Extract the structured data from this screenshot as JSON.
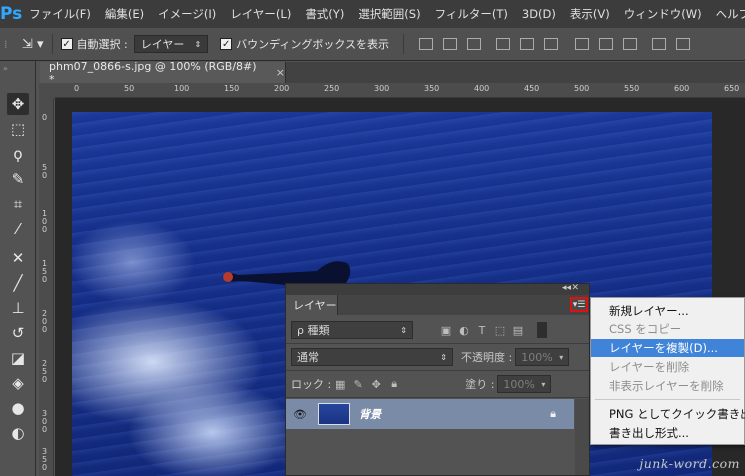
{
  "app": {
    "logo": "Ps"
  },
  "menubar": {
    "items": [
      "ファイル(F)",
      "編集(E)",
      "イメージ(I)",
      "レイヤー(L)",
      "書式(Y)",
      "選択範囲(S)",
      "フィルター(T)",
      "3D(D)",
      "表示(V)",
      "ウィンドウ(W)",
      "ヘルプ(H)"
    ]
  },
  "options": {
    "auto_select_label": "自動選択 :",
    "auto_select_value": "レイヤー",
    "bounding_box_label": "バウンディングボックスを表示"
  },
  "document": {
    "tab_title": "phm07_0866-s.jpg @ 100% (RGB/8#) *",
    "tab_close": "×"
  },
  "rulers": {
    "top": [
      "0",
      "50",
      "100",
      "150",
      "200",
      "250",
      "300",
      "350",
      "400",
      "450",
      "500",
      "550",
      "600",
      "650"
    ],
    "left": [
      "0",
      "5\n0",
      "1\n0\n0",
      "1\n5\n0",
      "2\n0\n0",
      "2\n5\n0",
      "3\n0\n0",
      "3\n5\n0"
    ]
  },
  "layers_panel": {
    "tab_label": "レイヤー",
    "kind_filter": "ρ 種類",
    "blend_mode": "通常",
    "opacity_label": "不透明度 :",
    "opacity_value": "100%",
    "lock_label": "ロック :",
    "fill_label": "塗り :",
    "fill_value": "100%",
    "layers": [
      {
        "name": "背景",
        "visible": true,
        "locked": true
      }
    ]
  },
  "flyout_menu": {
    "items": [
      {
        "label": "新規レイヤー...",
        "state": "normal"
      },
      {
        "label": "CSS をコピー",
        "state": "disabled"
      },
      {
        "label": "レイヤーを複製(D)...",
        "state": "highlighted"
      },
      {
        "label": "レイヤーを削除",
        "state": "disabled"
      },
      {
        "label": "非表示レイヤーを削除",
        "state": "disabled"
      },
      {
        "label": "PNG としてクイック書き出し",
        "state": "normal"
      },
      {
        "label": "書き出し形式...",
        "state": "normal"
      }
    ]
  },
  "watermark": "junk-word.com",
  "colors": {
    "highlight": "#3f84d8",
    "selected_layer": "#7a8ba8",
    "annotation_red": "#e01010"
  }
}
